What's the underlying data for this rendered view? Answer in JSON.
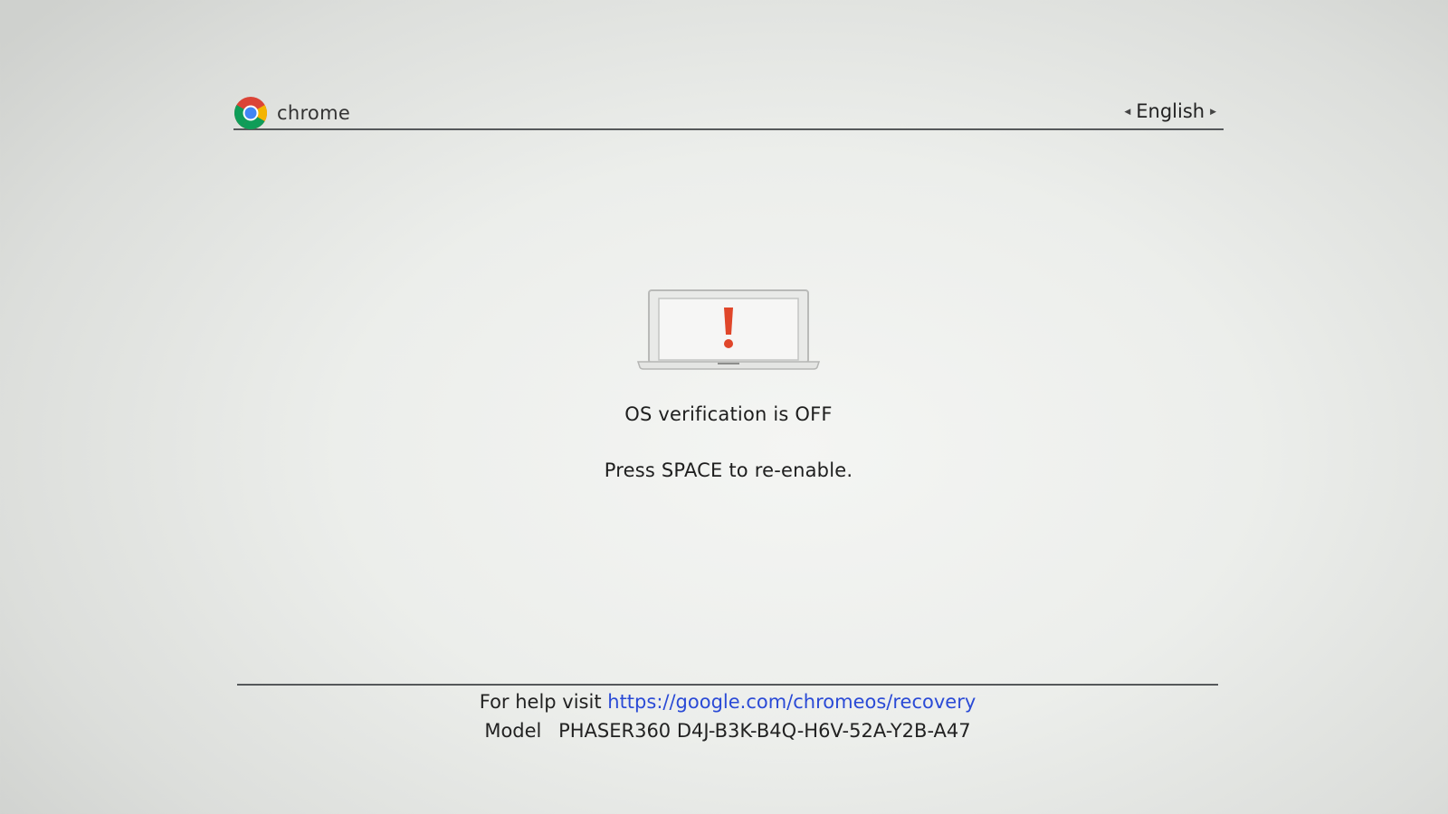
{
  "header": {
    "brand": "chrome",
    "language": "English",
    "language_prev_icon": "triangle-left-icon",
    "language_next_icon": "triangle-right-icon",
    "logo_icon": "chrome-logo-icon"
  },
  "main": {
    "icon": "laptop-warning-icon",
    "status": "OS verification is OFF",
    "instruction": "Press SPACE to re-enable."
  },
  "footer": {
    "help_prefix": "For help visit",
    "help_url": "https://google.com/chromeos/recovery",
    "model_label": "Model",
    "model_value": "PHASER360 D4J-B3K-B4Q-H6V-52A-Y2B-A47"
  },
  "colors": {
    "link": "#2a4ad6",
    "warning": "#e0462a",
    "background": "#eceeeb"
  }
}
